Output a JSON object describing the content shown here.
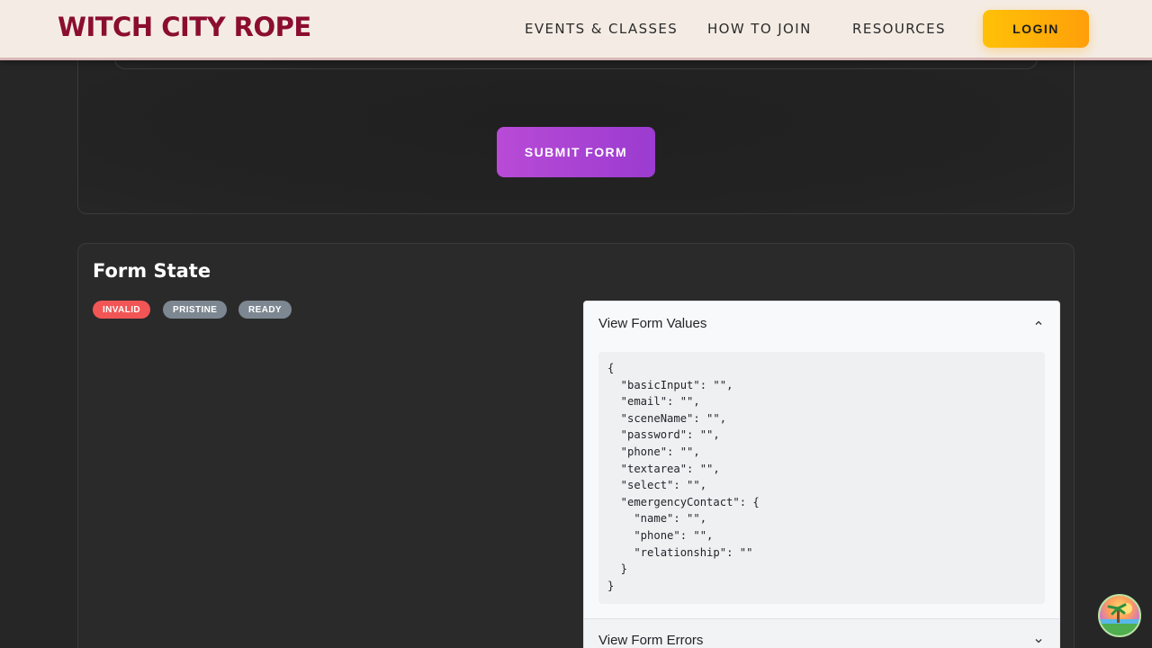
{
  "header": {
    "brand": "WITCH CITY ROPE",
    "nav": {
      "events": "EVENTS & CLASSES",
      "join": "HOW TO JOIN",
      "resources": "RESOURCES"
    },
    "login": "LOGIN"
  },
  "form": {
    "submit_label": "SUBMIT FORM"
  },
  "state": {
    "title": "Form State",
    "badges": {
      "invalid": "INVALID",
      "pristine": "PRISTINE",
      "ready": "READY"
    },
    "values_label": "View Form Values",
    "values_json": "{\n  \"basicInput\": \"\",\n  \"email\": \"\",\n  \"sceneName\": \"\",\n  \"password\": \"\",\n  \"phone\": \"\",\n  \"textarea\": \"\",\n  \"select\": \"\",\n  \"emergencyContact\": {\n    \"name\": \"\",\n    \"phone\": \"\",\n    \"relationship\": \"\"\n  }\n}",
    "errors_label": "View Form Errors"
  },
  "colors": {
    "brand": "#8b0d2f",
    "login": "#ffb20a",
    "submit": "#b84bd6",
    "invalid": "#f25555",
    "neutral_badge": "#7d8791"
  },
  "icons": {
    "values_chevron": "chevron-up-icon",
    "errors_chevron": "chevron-down-icon",
    "float": "avatar-icon"
  }
}
